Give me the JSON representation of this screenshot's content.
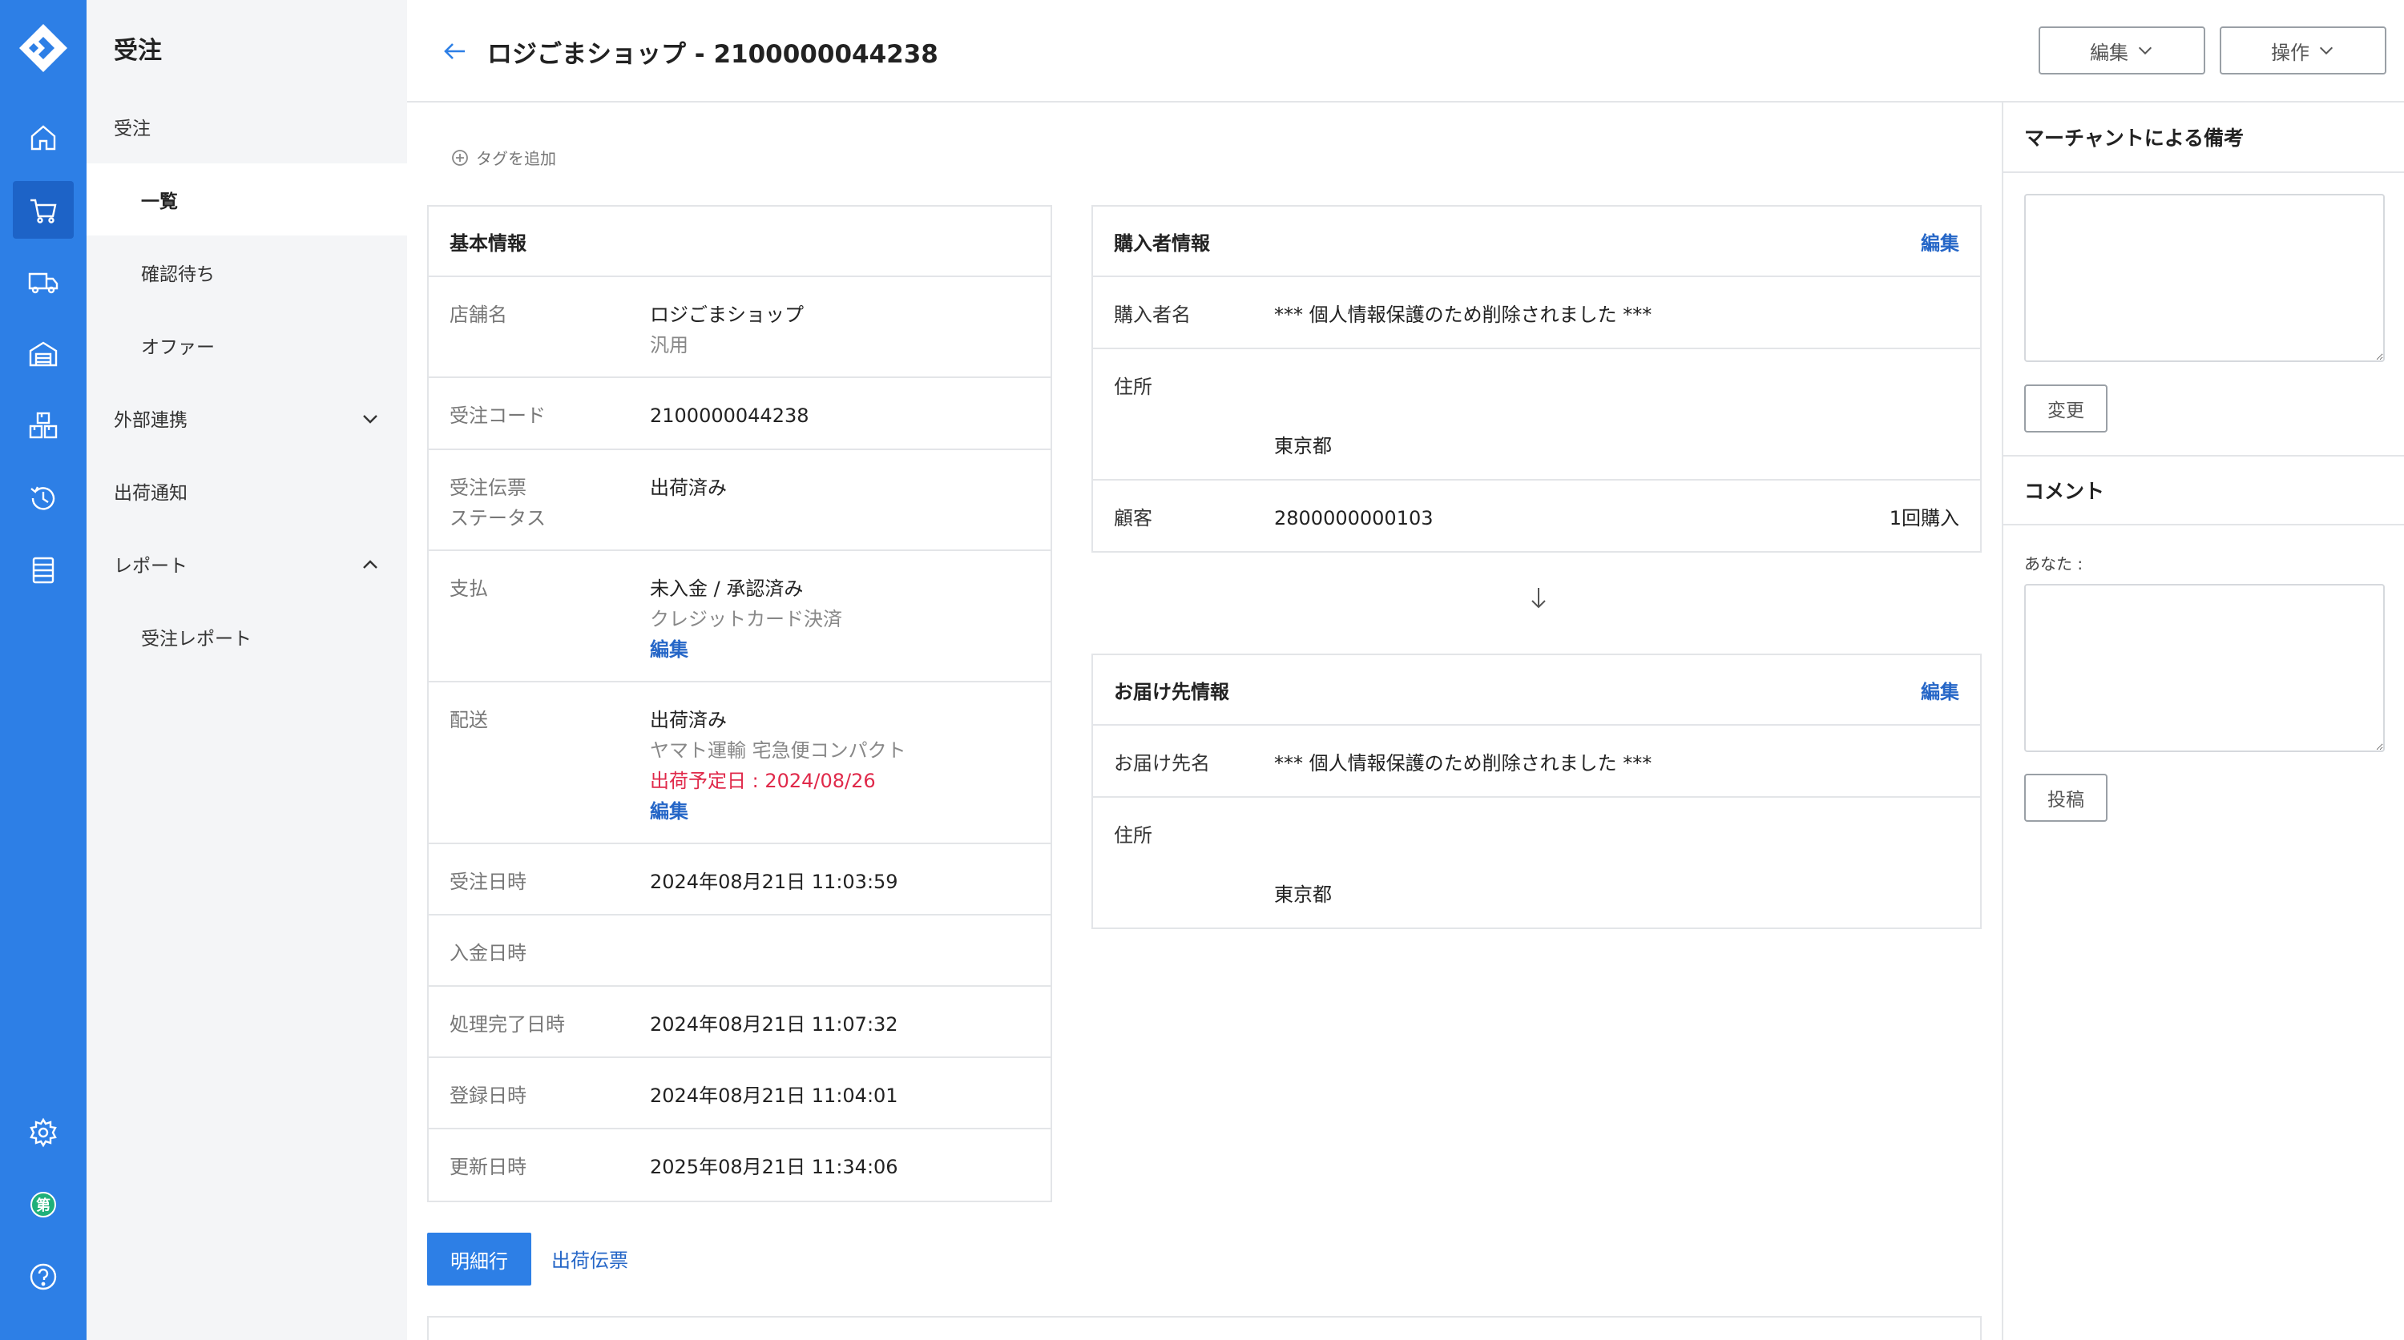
{
  "rail": {
    "items": [
      "home-icon",
      "cart-icon",
      "truck-icon",
      "warehouse-icon",
      "boxes-icon",
      "history-icon",
      "document-list-icon"
    ],
    "bottom": [
      "gear-icon",
      "user-avatar",
      "help-icon"
    ],
    "avatar_text": "第",
    "accent": "#2d7fe6"
  },
  "sidebar": {
    "title": "受注",
    "items": [
      {
        "label": "受注"
      },
      {
        "label": "一覧"
      },
      {
        "label": "確認待ち"
      },
      {
        "label": "オファー"
      },
      {
        "label": "外部連携"
      },
      {
        "label": "出荷通知"
      },
      {
        "label": "レポート"
      },
      {
        "label": "受注レポート"
      }
    ]
  },
  "header": {
    "title": "ロジごまショップ - 2100000044238",
    "edit_label": "編集",
    "ops_label": "操作"
  },
  "tags": {
    "add_label": "タグを追加"
  },
  "basic": {
    "title": "基本情報",
    "store_label": "店舗名",
    "store_value": "ロジごまショップ",
    "store_sub": "汎用",
    "code_label": "受注コード",
    "code_value": "2100000044238",
    "status_label_1": "受注伝票",
    "status_label_2": "ステータス",
    "status_value": "出荷済み",
    "pay_label": "支払",
    "pay_value": "未入金 / 承認済み",
    "pay_method": "クレジットカード決済",
    "pay_edit": "編集",
    "ship_label": "配送",
    "ship_value": "出荷済み",
    "ship_carrier": "ヤマト運輸 宅急便コンパクト",
    "ship_date": "出荷予定日 : 2024/08/26",
    "ship_edit": "編集",
    "order_date_label": "受注日時",
    "order_date_value": "2024年08月21日 11:03:59",
    "paid_date_label": "入金日時",
    "done_date_label": "処理完了日時",
    "done_date_value": "2024年08月21日 11:07:32",
    "reg_date_label": "登録日時",
    "reg_date_value": "2024年08月21日 11:04:01",
    "upd_date_label": "更新日時",
    "upd_date_value": "2025年08月21日 11:34:06"
  },
  "buyer": {
    "title": "購入者情報",
    "edit": "編集",
    "name_label": "購入者名",
    "name_value": "*** 個人情報保護のため削除されました ***",
    "addr_label": "住所",
    "addr_value": "東京都",
    "cust_label": "顧客",
    "cust_value": "2800000000103",
    "cust_count": "1回購入"
  },
  "delivery": {
    "title": "お届け先情報",
    "edit": "編集",
    "name_label": "お届け先名",
    "name_value": "*** 個人情報保護のため削除されました ***",
    "addr_label": "住所",
    "addr_value": "東京都"
  },
  "merchant": {
    "title": "マーチャントによる備考",
    "change_label": "変更"
  },
  "comment": {
    "title": "コメント",
    "you_label": "あなた :",
    "post_label": "投稿"
  },
  "tabs": {
    "active": "明細行",
    "other": "出荷伝票"
  }
}
